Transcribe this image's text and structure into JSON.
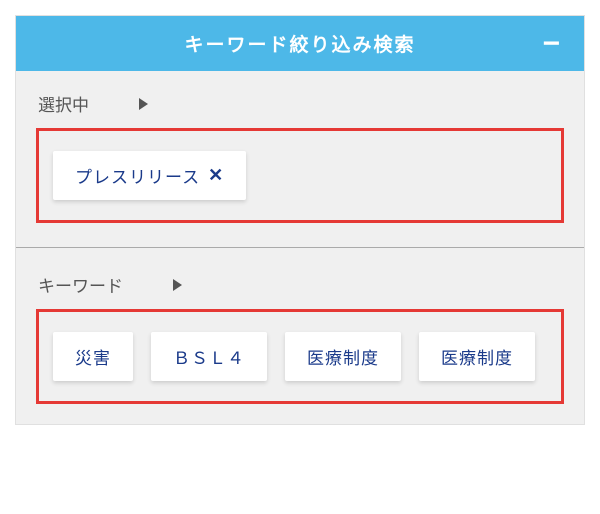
{
  "header": {
    "title": "キーワード絞り込み検索",
    "collapse_icon": "−"
  },
  "selected": {
    "label": "選択中",
    "items": [
      {
        "label": "プレスリリース",
        "closeable": true
      }
    ]
  },
  "keywords": {
    "label": "キーワード",
    "items": [
      {
        "label": "災害"
      },
      {
        "label": "ＢＳＬ４"
      },
      {
        "label": "医療制度"
      },
      {
        "label": "医療制度"
      }
    ]
  }
}
